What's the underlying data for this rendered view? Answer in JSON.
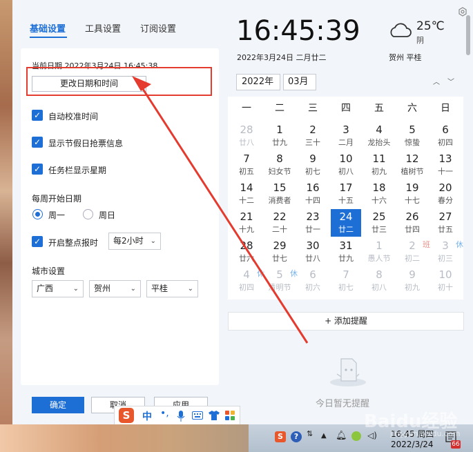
{
  "tabs": {
    "basic": "基础设置",
    "tools": "工具设置",
    "subscribe": "订阅设置"
  },
  "settings": {
    "current_date": "当前日期 2022年3月24日 16:45:38",
    "change_button": "更改日期和时间",
    "auto_sync": "自动校准时间",
    "holiday_info": "显示节假日抢票信息",
    "taskbar_weekday": "任务栏显示星期",
    "week_start_title": "每周开始日期",
    "monday": "周一",
    "sunday": "周日",
    "hourly_chime": "开启整点报时",
    "chime_interval": "每2小时",
    "city_title": "城市设置",
    "province": "广西",
    "city": "贺州",
    "county": "平桂"
  },
  "buttons": {
    "confirm": "确定",
    "cancel": "取消",
    "apply": "应用"
  },
  "clock": {
    "time": "16:45:39",
    "date": "2022年3月24日  二月廿二"
  },
  "weather": {
    "temp": "25℃",
    "cond": "阴",
    "location": "贺州  平桂"
  },
  "calendar": {
    "year": "2022年",
    "month": "03月",
    "weekdays": [
      "一",
      "二",
      "三",
      "四",
      "五",
      "六",
      "日"
    ],
    "weeks": [
      [
        {
          "n": "28",
          "l": "廿八",
          "o": true
        },
        {
          "n": "1",
          "l": "廿九"
        },
        {
          "n": "2",
          "l": "三十"
        },
        {
          "n": "3",
          "l": "二月"
        },
        {
          "n": "4",
          "l": "龙抬头"
        },
        {
          "n": "5",
          "l": "惊蛰"
        },
        {
          "n": "6",
          "l": "初四"
        }
      ],
      [
        {
          "n": "7",
          "l": "初五"
        },
        {
          "n": "8",
          "l": "妇女节"
        },
        {
          "n": "9",
          "l": "初七"
        },
        {
          "n": "10",
          "l": "初八"
        },
        {
          "n": "11",
          "l": "初九"
        },
        {
          "n": "12",
          "l": "植树节"
        },
        {
          "n": "13",
          "l": "十一"
        }
      ],
      [
        {
          "n": "14",
          "l": "十二"
        },
        {
          "n": "15",
          "l": "消费者"
        },
        {
          "n": "16",
          "l": "十四"
        },
        {
          "n": "17",
          "l": "十五"
        },
        {
          "n": "18",
          "l": "十六"
        },
        {
          "n": "19",
          "l": "十七"
        },
        {
          "n": "20",
          "l": "春分"
        }
      ],
      [
        {
          "n": "21",
          "l": "十九"
        },
        {
          "n": "22",
          "l": "二十"
        },
        {
          "n": "23",
          "l": "廿一"
        },
        {
          "n": "24",
          "l": "廿二",
          "t": true
        },
        {
          "n": "25",
          "l": "廿三"
        },
        {
          "n": "26",
          "l": "廿四"
        },
        {
          "n": "27",
          "l": "廿五"
        }
      ],
      [
        {
          "n": "28",
          "l": "廿六"
        },
        {
          "n": "29",
          "l": "廿七"
        },
        {
          "n": "30",
          "l": "廿八"
        },
        {
          "n": "31",
          "l": "廿九"
        },
        {
          "n": "1",
          "l": "愚人节",
          "o": true
        },
        {
          "n": "2",
          "l": "初二",
          "o": true,
          "tag": "班",
          "tt": "work"
        },
        {
          "n": "3",
          "l": "初三",
          "o": true,
          "tag": "休",
          "tt": "rest"
        }
      ],
      [
        {
          "n": "4",
          "l": "初四",
          "o": true,
          "tag": "休",
          "tt": "rest"
        },
        {
          "n": "5",
          "l": "清明节",
          "o": true,
          "tag": "休",
          "tt": "rest"
        },
        {
          "n": "6",
          "l": "初六",
          "o": true
        },
        {
          "n": "7",
          "l": "初七",
          "o": true
        },
        {
          "n": "8",
          "l": "初八",
          "o": true
        },
        {
          "n": "9",
          "l": "初九",
          "o": true
        },
        {
          "n": "10",
          "l": "初十",
          "o": true
        }
      ]
    ],
    "add_reminder": "+ 添加提醒",
    "empty": "今日暂无提醒"
  },
  "taskbar": {
    "time": "16:45 周四",
    "date": "2022/3/24",
    "ime": "中",
    "badge": "66",
    "sogou": "S",
    "help": "?"
  },
  "watermark": {
    "text": "Baidu经验",
    "sub": "jingyan.baidu.com"
  },
  "colors": {
    "accent": "#1d6fd6",
    "annotation": "#e53a2e"
  }
}
